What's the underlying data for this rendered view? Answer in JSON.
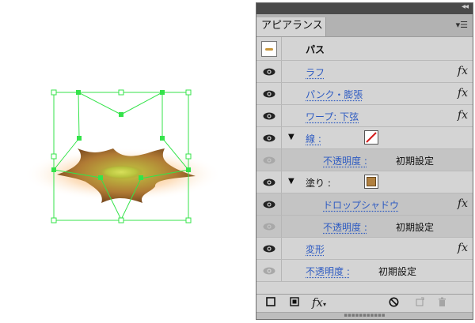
{
  "panel": {
    "title": "アピアランス",
    "object_name": "パス",
    "menu_icon": "panel-menu-icon",
    "rows": {
      "rough": {
        "label": "ラフ",
        "fx": "fx"
      },
      "pucker": {
        "label": "パンク・膨張",
        "fx": "fx"
      },
      "warp": {
        "label": "ワープ: 下弦",
        "fx": "fx"
      },
      "stroke": {
        "label": "線 :"
      },
      "stroke_opacity": {
        "label": "不透明度 :",
        "value": "初期設定"
      },
      "fill": {
        "label": "塗り :"
      },
      "drop_shadow": {
        "label": "ドロップシャドウ",
        "fx": "fx"
      },
      "fill_opacity": {
        "label": "不透明度 :",
        "value": "初期設定"
      },
      "transform": {
        "label": "変形",
        "fx": "fx"
      },
      "opacity": {
        "label": "不透明度 :",
        "value": "初期設定"
      }
    },
    "bottom_icons": [
      "add-new-stroke-icon",
      "add-new-fill-icon",
      "fx-menu-icon",
      "clear-appearance-icon",
      "duplicate-item-icon",
      "delete-item-icon"
    ],
    "fx_glyph": "fx"
  },
  "colors": {
    "selection": "#34e34a",
    "link": "#2e5bc2",
    "glow": "#f7b36a",
    "fill_swatch": "#b08040"
  }
}
